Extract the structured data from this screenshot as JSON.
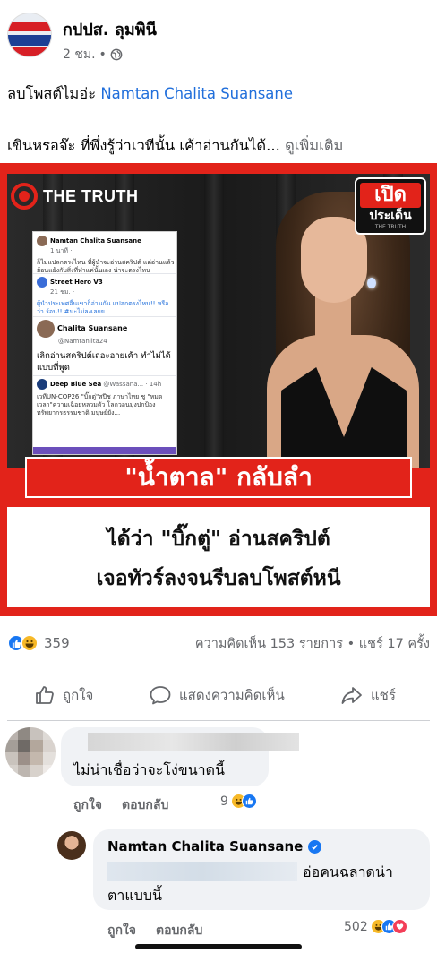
{
  "post": {
    "page_name": "กปปส. ลุมพินี",
    "time": "2 ชม.",
    "dot": "•",
    "line1_prefix": "ลบโพสต์ไมอ่ะ",
    "line1_link": "Namtan Chalita Suansane",
    "line2_text": "เขินหรอจ๊ะ ที่พึ่งรู้ว่าเวทีนั้น เค้าอ่านกันได้...",
    "see_more": "ดูเพิ่มเติม"
  },
  "news_image": {
    "brand": "THE TRUTH",
    "badge_line1": "เปิด",
    "badge_line2": "ประเด็น",
    "badge_line3": "THE TRUTH",
    "headline_red": "\"น้ำตาล\" กลับลำ",
    "headline_line1": "ได้ว่า \"บิ๊กตู่\" อ่านสคริปต์",
    "headline_line2": "เจอทัวร์ลงจนรีบลบโพสต์หนี",
    "collage": {
      "post_name": "Namtan Chalita Suansane",
      "post_time": "1 นาที · ",
      "post_text": "ก็ไม่แปลกตรงไหน ที่ผู้นำจะอ่านสคริปต์ แต่อ่านแล้ว ย้อนแย้งกับสิ่งที่ทำแค่นั้นเอง น่าจะตรงไหน",
      "reply1_name": "Street Hero V3",
      "reply1_time": "21 ชม. ·",
      "reply1_text": "ผู้นำประเทศอื่นเขาก็อ่านกัน แปลกตรงไหน!! หรือว่า ร้อน!! #นะไม่ลงเลยย",
      "quote_name": "Chalita Suansane",
      "quote_handle": "@Namtanlita24",
      "quote_text": "เลิกอ่านสคริปต์เถอะอายเค้า ทำไม่ได้แบบที่พูด",
      "inner_name": "Deep Blue Sea",
      "inner_handle": "@Wassana... · 14h",
      "inner_text": "เวทีUN-COP26 \"บิ๊กตู่\"สปีช ภาษาไทย ชู \"หมดเวลา\"ความเฉื่อยหลวมตัว โลกวอนมุ่งปกป้องทรัพยากรธรรมชาติ มนุษย์ยัง..."
    }
  },
  "summary": {
    "reaction_count": "359",
    "stats": "ความคิดเห็น 153 รายการ • แชร์ 17 ครั้ง"
  },
  "actions": {
    "like": "ถูกใจ",
    "comment": "แสดงความคิดเห็น",
    "share": "แชร์"
  },
  "comments": [
    {
      "text": "ไม่น่าเชื่อว่าจะโง่ขนาดนี้",
      "like": "ถูกใจ",
      "reply": "ตอบกลับ",
      "reaction_count": "9"
    },
    {
      "name": "Namtan Chalita Suansane",
      "text_a": "อ่อคนฉลาดน่า",
      "text_b": "ตาแบบนี้",
      "like": "ถูกใจ",
      "reply": "ตอบกลับ",
      "reaction_count": "502"
    }
  ],
  "colors": {
    "facebook_blue": "#1877f2",
    "link_blue": "#216fdb",
    "news_red": "#e2231a",
    "muted_text": "#65676b",
    "comment_bg": "#f0f2f5"
  },
  "icons": [
    "globe-icon",
    "like-icon",
    "haha-icon",
    "love-icon",
    "comment-icon",
    "share-icon",
    "verified-icon"
  ]
}
